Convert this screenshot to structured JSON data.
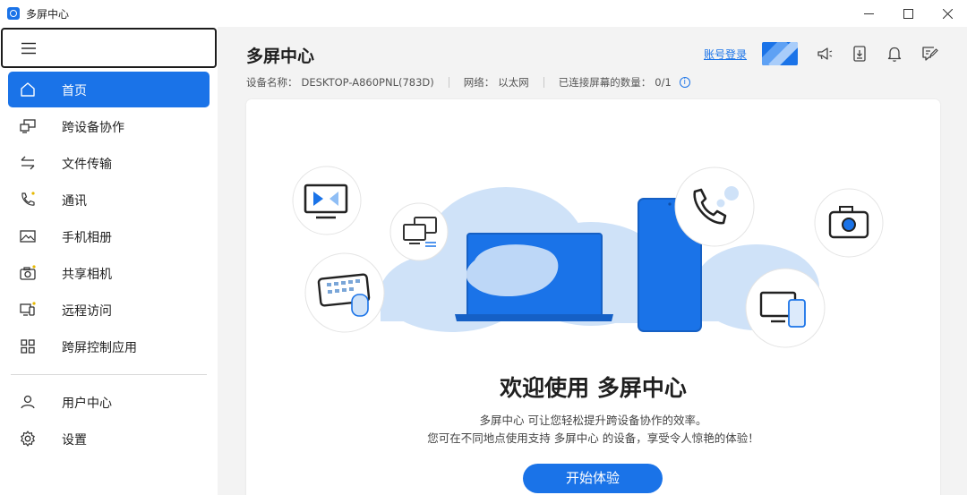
{
  "window": {
    "title": "多屏中心"
  },
  "sidebar": {
    "items": [
      {
        "label": "首页",
        "icon": "home-icon",
        "active": true
      },
      {
        "label": "跨设备协作",
        "icon": "cross-device-icon",
        "active": false
      },
      {
        "label": "文件传输",
        "icon": "transfer-arrows-icon",
        "active": false
      },
      {
        "label": "通讯",
        "icon": "phone-icon",
        "active": false
      },
      {
        "label": "手机相册",
        "icon": "photo-icon",
        "active": false
      },
      {
        "label": "共享相机",
        "icon": "camera-icon",
        "active": false
      },
      {
        "label": "远程访问",
        "icon": "remote-access-icon",
        "active": false
      },
      {
        "label": "跨屏控制应用",
        "icon": "apps-grid-icon",
        "active": false
      }
    ],
    "bottom_items": [
      {
        "label": "用户中心",
        "icon": "user-icon"
      },
      {
        "label": "设置",
        "icon": "gear-icon"
      }
    ]
  },
  "main": {
    "title": "多屏中心",
    "device_name_label": "设备名称：",
    "device_name": "DESKTOP-A860PNL(783D)",
    "network_label": "网络：",
    "network": "以太网",
    "connected_label": "已连接屏幕的数量：",
    "connected": "0/1",
    "login_link": "账号登录"
  },
  "welcome": {
    "heading": "欢迎使用 多屏中心",
    "line1": "多屏中心 可让您轻松提升跨设备协作的效率。",
    "line2": "您可在不同地点使用支持 多屏中心 的设备，享受令人惊艳的体验！",
    "button": "开始体验"
  },
  "colors": {
    "accent": "#1a73e8",
    "cloud": "#cfe2f8",
    "sidebar_bg": "#ffffff",
    "app_bg": "#f3f3f3"
  }
}
